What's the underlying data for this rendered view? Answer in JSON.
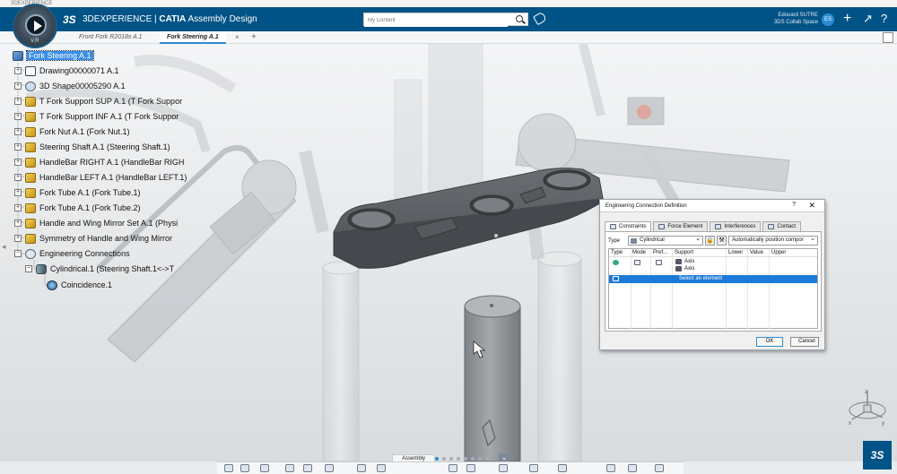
{
  "os_bar": {
    "title": "3DEXPERIENCE"
  },
  "topbar": {
    "brand_prefix": "3DEXPERIENCE | ",
    "brand_app": "CATIA",
    "brand_suffix": " Assembly Design",
    "search_placeholder": "My Content",
    "user_name": "Edouard SUTRE",
    "user_space": "3DS Collab Space",
    "avatar_initials": "ES",
    "version_label": "V.R"
  },
  "tabs": [
    {
      "label": "Front Fork R2018x A.1"
    },
    {
      "label": "Fork Steering A.1"
    }
  ],
  "tree": {
    "nodes": [
      {
        "label": "Fork Steering A.1",
        "icon": "product-icon"
      },
      {
        "label": "Drawing00000071 A.1",
        "icon": "drawing-icon"
      },
      {
        "label": "3D Shape00005290 A.1",
        "icon": "shape-icon"
      },
      {
        "label": "T Fork Support SUP A.1 (T Fork Suppor",
        "icon": "part-icon"
      },
      {
        "label": "T Fork Support INF A.1 (T Fork Suppor",
        "icon": "part-icon"
      },
      {
        "label": "Fork Nut A.1 (Fork Nut.1)",
        "icon": "part-icon"
      },
      {
        "label": "Steering Shaft A.1 (Steering Shaft.1)",
        "icon": "part-icon"
      },
      {
        "label": "HandleBar RIGHT A.1 (HandleBar RIGH",
        "icon": "part-icon"
      },
      {
        "label": "HandleBar LEFT A.1 (HandleBar LEFT.1)",
        "icon": "part-icon"
      },
      {
        "label": "Fork Tube A.1 (Fork Tube.1)",
        "icon": "part-icon"
      },
      {
        "label": "Fork Tube A.1 (Fork Tube.2)",
        "icon": "part-icon"
      },
      {
        "label": "Handle and Wing Mirror Set A.1 (Physi",
        "icon": "part-icon"
      },
      {
        "label": "Symmetry of Handle and Wing Mirror",
        "icon": "part-icon"
      },
      {
        "label": "Engineering Connections",
        "icon": "connections-icon"
      },
      {
        "label": "Cylindrical.1 (Steering Shaft.1<->T",
        "icon": "cylindrical-icon"
      },
      {
        "label": "Coincidence.1",
        "icon": "coincidence-icon"
      }
    ]
  },
  "dialog": {
    "title": "Engineering Connection Definition",
    "help": "?",
    "close": "✕",
    "tabs": [
      {
        "label": "Constraints"
      },
      {
        "label": "Force Element"
      },
      {
        "label": "Interferences"
      },
      {
        "label": "Contact"
      }
    ],
    "type_label": "Type",
    "type_value": "Cylindrical",
    "position_value": "Automatically position compor",
    "columns": [
      "Type",
      "Mode",
      "Pref...",
      "Support",
      "Lower",
      "Value",
      "Upper"
    ],
    "rows": [
      {
        "supports": [
          "Axis",
          "Axis"
        ]
      },
      {
        "support": "Select an element"
      }
    ],
    "ok_label": "OK",
    "cancel_label": "Cancel"
  },
  "action_bar": {
    "section_label": "Assembly"
  },
  "colors": {
    "topbar": "#005386",
    "accent": "#2c8cd2",
    "selection": "#1e7ad8"
  }
}
